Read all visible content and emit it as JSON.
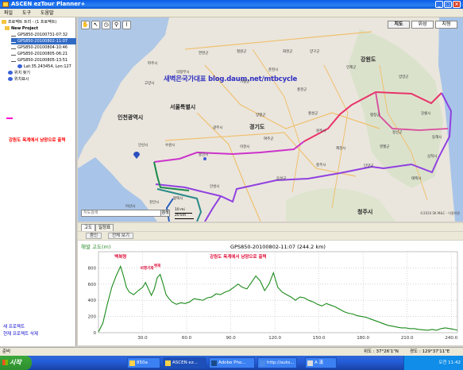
{
  "window": {
    "title": "ASCEN ezTour Planner+"
  },
  "menu": [
    "파일",
    "도구",
    "도움말"
  ],
  "tree": {
    "root": "프로젝트 트리 - (1 프로젝트)",
    "project": "New Project",
    "tracks": [
      "GPS850-20100731-07:32",
      "GPS850-20100802-11:07",
      "GPS850-20100804-10:46",
      "GPS850-20100805-06:21",
      "GPS850-20100805-13:51"
    ],
    "selected_index": 1,
    "coords": "Lat:35.243454, Lon:127",
    "items": [
      "위치 찾기",
      "위치표시"
    ]
  },
  "annotation": "강원도 옥계에서 남양으로 출력",
  "left_bottom": [
    "새 프로젝트",
    "현재 프로젝트 삭제"
  ],
  "map": {
    "maptypes": [
      "지도",
      "위성",
      "지형"
    ],
    "active_maptype": "지도",
    "watermark": "새벽은국가대표 blog.daum.net/mtbcycle",
    "labels": {
      "seoul": "서울특별시",
      "incheon": "인천광역시",
      "gyeonggi": "경기도",
      "gangwon": "강원도",
      "cheongju": "청주시",
      "chuncheon": "춘천시",
      "wonju": "원주시",
      "suwon": "수원시",
      "yongin": "용인시",
      "icheon": "이천시",
      "ansan": "안산시",
      "chungju": "충주시",
      "jecheon": "제천시",
      "pyeongtaek": "평택시",
      "goyang": "고양시",
      "uijeongbu": "의정부시",
      "hongcheon": "홍천군",
      "hoengseong": "횡성군",
      "taebaek": "태백시",
      "samcheok": "삼척시",
      "donghae": "동해시",
      "gangneung": "강릉시",
      "yangyang": "양양군",
      "inje": "인제군",
      "yanggu": "양구군",
      "hwacheon": "화천군",
      "cheorwon": "철원군",
      "paju": "파주시",
      "yeoncheon": "연천군",
      "gapyeong": "가평군",
      "yangpyeong": "양평군",
      "yeoju": "여주군",
      "gwangju": "광주시",
      "anseong": "안성시",
      "eumseong": "음성군",
      "danyang": "단양군",
      "yeongwol": "영월군",
      "jeongseon": "정선군",
      "pyeongchang": "평창군",
      "asan": "아산시",
      "cheonan": "천안시"
    },
    "search_placeholder": "지도검색",
    "search_button": "검색",
    "scale_mi": "10 mi",
    "scale_km": "20 km",
    "copyright": "©2010 SK M&C - 이용약관"
  },
  "tabs": [
    "고도",
    "일정표"
  ],
  "active_tab": "고도",
  "elevation_buttons": [
    "줌인",
    "전체 보기"
  ],
  "chart_data": {
    "type": "line",
    "title": "GPS850-20100802-11:07 (244.2 km)",
    "ylabel": "해발 고도(m)",
    "xlabel": "",
    "ylim": [
      0,
      1000
    ],
    "xlim": [
      0,
      244.2
    ],
    "x_ticks": [
      30.0,
      60.0,
      90.0,
      120.0,
      150.0,
      180.0,
      210.0,
      240.0
    ],
    "y_ticks": [
      0,
      200,
      400,
      600,
      800
    ],
    "grid": true,
    "annotations": [
      {
        "text": "백복령",
        "x": 15
      },
      {
        "text": "비행기재",
        "x": 33
      },
      {
        "text": "벳재",
        "x": 40
      },
      {
        "text": "강원도 옥계에서 남양으로 출력",
        "x": 95
      }
    ],
    "series": [
      {
        "x": [
          0,
          3,
          6,
          9,
          12,
          15,
          17,
          19,
          21,
          24,
          27,
          30,
          32,
          34,
          36,
          38,
          40,
          42,
          44,
          46,
          48,
          50,
          53,
          56,
          59,
          62,
          65,
          68,
          71,
          74,
          77,
          80,
          83,
          86,
          89,
          92,
          95,
          98,
          101,
          104,
          107,
          110,
          113,
          116,
          119,
          122,
          125,
          128,
          131,
          134,
          137,
          140,
          143,
          146,
          149,
          152,
          155,
          158,
          161,
          164,
          167,
          170,
          173,
          176,
          179,
          182,
          185,
          188,
          191,
          194,
          197,
          200,
          203,
          206,
          209,
          212,
          215,
          218,
          221,
          224,
          227,
          230,
          233,
          236,
          239,
          242,
          244.2
        ],
        "values": [
          10,
          120,
          350,
          560,
          700,
          820,
          700,
          560,
          500,
          470,
          520,
          560,
          620,
          540,
          460,
          540,
          680,
          720,
          600,
          470,
          420,
          380,
          350,
          370,
          360,
          380,
          420,
          410,
          400,
          430,
          440,
          480,
          470,
          500,
          520,
          560,
          600,
          560,
          540,
          620,
          700,
          640,
          520,
          600,
          740,
          560,
          500,
          470,
          440,
          400,
          440,
          430,
          400,
          380,
          350,
          330,
          360,
          340,
          320,
          290,
          260,
          240,
          230,
          210,
          200,
          190,
          170,
          150,
          130,
          110,
          90,
          80,
          70,
          60,
          60,
          50,
          50,
          40,
          35,
          30,
          40,
          30,
          50,
          60,
          50,
          40,
          30
        ]
      }
    ]
  },
  "status": {
    "left": "준비",
    "lat": "위도 : 37°26'1\"N",
    "lon": "경도 : 129°37'11\"E"
  },
  "taskbar": {
    "start": "시작",
    "tasks": [
      "850a",
      "ASCEN ez...",
      "Adobe Pho...",
      "http://auto...",
      "A 漢"
    ],
    "clock": "오전 11:42"
  }
}
